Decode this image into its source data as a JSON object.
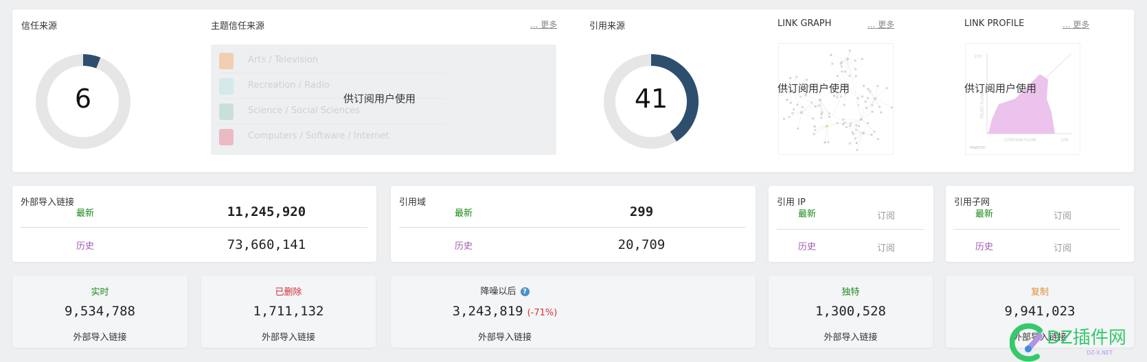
{
  "top_panel": {
    "trust_flow": {
      "title": "信任来源",
      "value": "6",
      "value_fraction": 0.06,
      "fill_color": "#2e4e6e",
      "track_color": "#e6e6e6"
    },
    "topical_trust_flow": {
      "title": "主题信任来源",
      "more_label": "... 更多",
      "overlay": "供订阅用户使用",
      "topics": [
        {
          "label": "Arts / Television",
          "color": "#f5b27a"
        },
        {
          "label": "Recreation / Radio",
          "color": "#bfe3e0"
        },
        {
          "label": "Science / Social Sciences",
          "color": "#a9d4cc"
        },
        {
          "label": "Computers / Software / Internet",
          "color": "#e8909c"
        }
      ]
    },
    "citation_flow": {
      "title": "引用来源",
      "value": "41",
      "value_fraction": 0.41,
      "fill_color": "#2e4e6e",
      "track_color": "#e6e6e6"
    },
    "link_graph": {
      "title": "LINK GRAPH",
      "more_label": "... 更多",
      "overlay": "供订阅用户使用"
    },
    "link_profile": {
      "title": "LINK PROFILE",
      "more_label": "... 更多",
      "overlay": "供订阅用户使用",
      "y_axis_label": "TRUST FLOW",
      "x_axis_label": "CITATION FLOW",
      "axis_max": "100",
      "brand": "MAJESTIC"
    }
  },
  "stats_row": {
    "new_label": "最新",
    "history_label": "历史",
    "backlinks": {
      "title": "外部导入链接",
      "new_value": "11,245,920",
      "history_value": "73,660,141"
    },
    "ref_domains": {
      "title": "引用域",
      "new_value": "299",
      "history_value": "20,709"
    },
    "ref_ips": {
      "title": "引用 IP",
      "new_value": "订阅",
      "history_value": "订阅"
    },
    "ref_subnets": {
      "title": "引用子网",
      "new_value": "订阅",
      "history_value": "订阅"
    }
  },
  "breakdown_row": [
    {
      "title": "实时",
      "title_color": "#1a8a1a",
      "value": "9,534,788",
      "sub": "外部导入链接"
    },
    {
      "title": "已删除",
      "title_color": "#d0303a",
      "value": "1,711,132",
      "sub": "外部导入链接"
    },
    {
      "title": "降噪以后",
      "title_color": "#333333",
      "value": "3,243,819",
      "change": "(-71%)",
      "sub": "外部导入链接",
      "help_icon": "?"
    },
    {
      "title": "独特",
      "title_color": "#1a8a1a",
      "value": "1,300,528",
      "sub": "外部导入链接"
    },
    {
      "title": "复制",
      "title_color": "#e0903a",
      "value": "9,941,023",
      "sub": "外部导入链接"
    }
  ],
  "watermark": {
    "text": "DZ插件网",
    "subtext": "DZ-X.NET"
  }
}
